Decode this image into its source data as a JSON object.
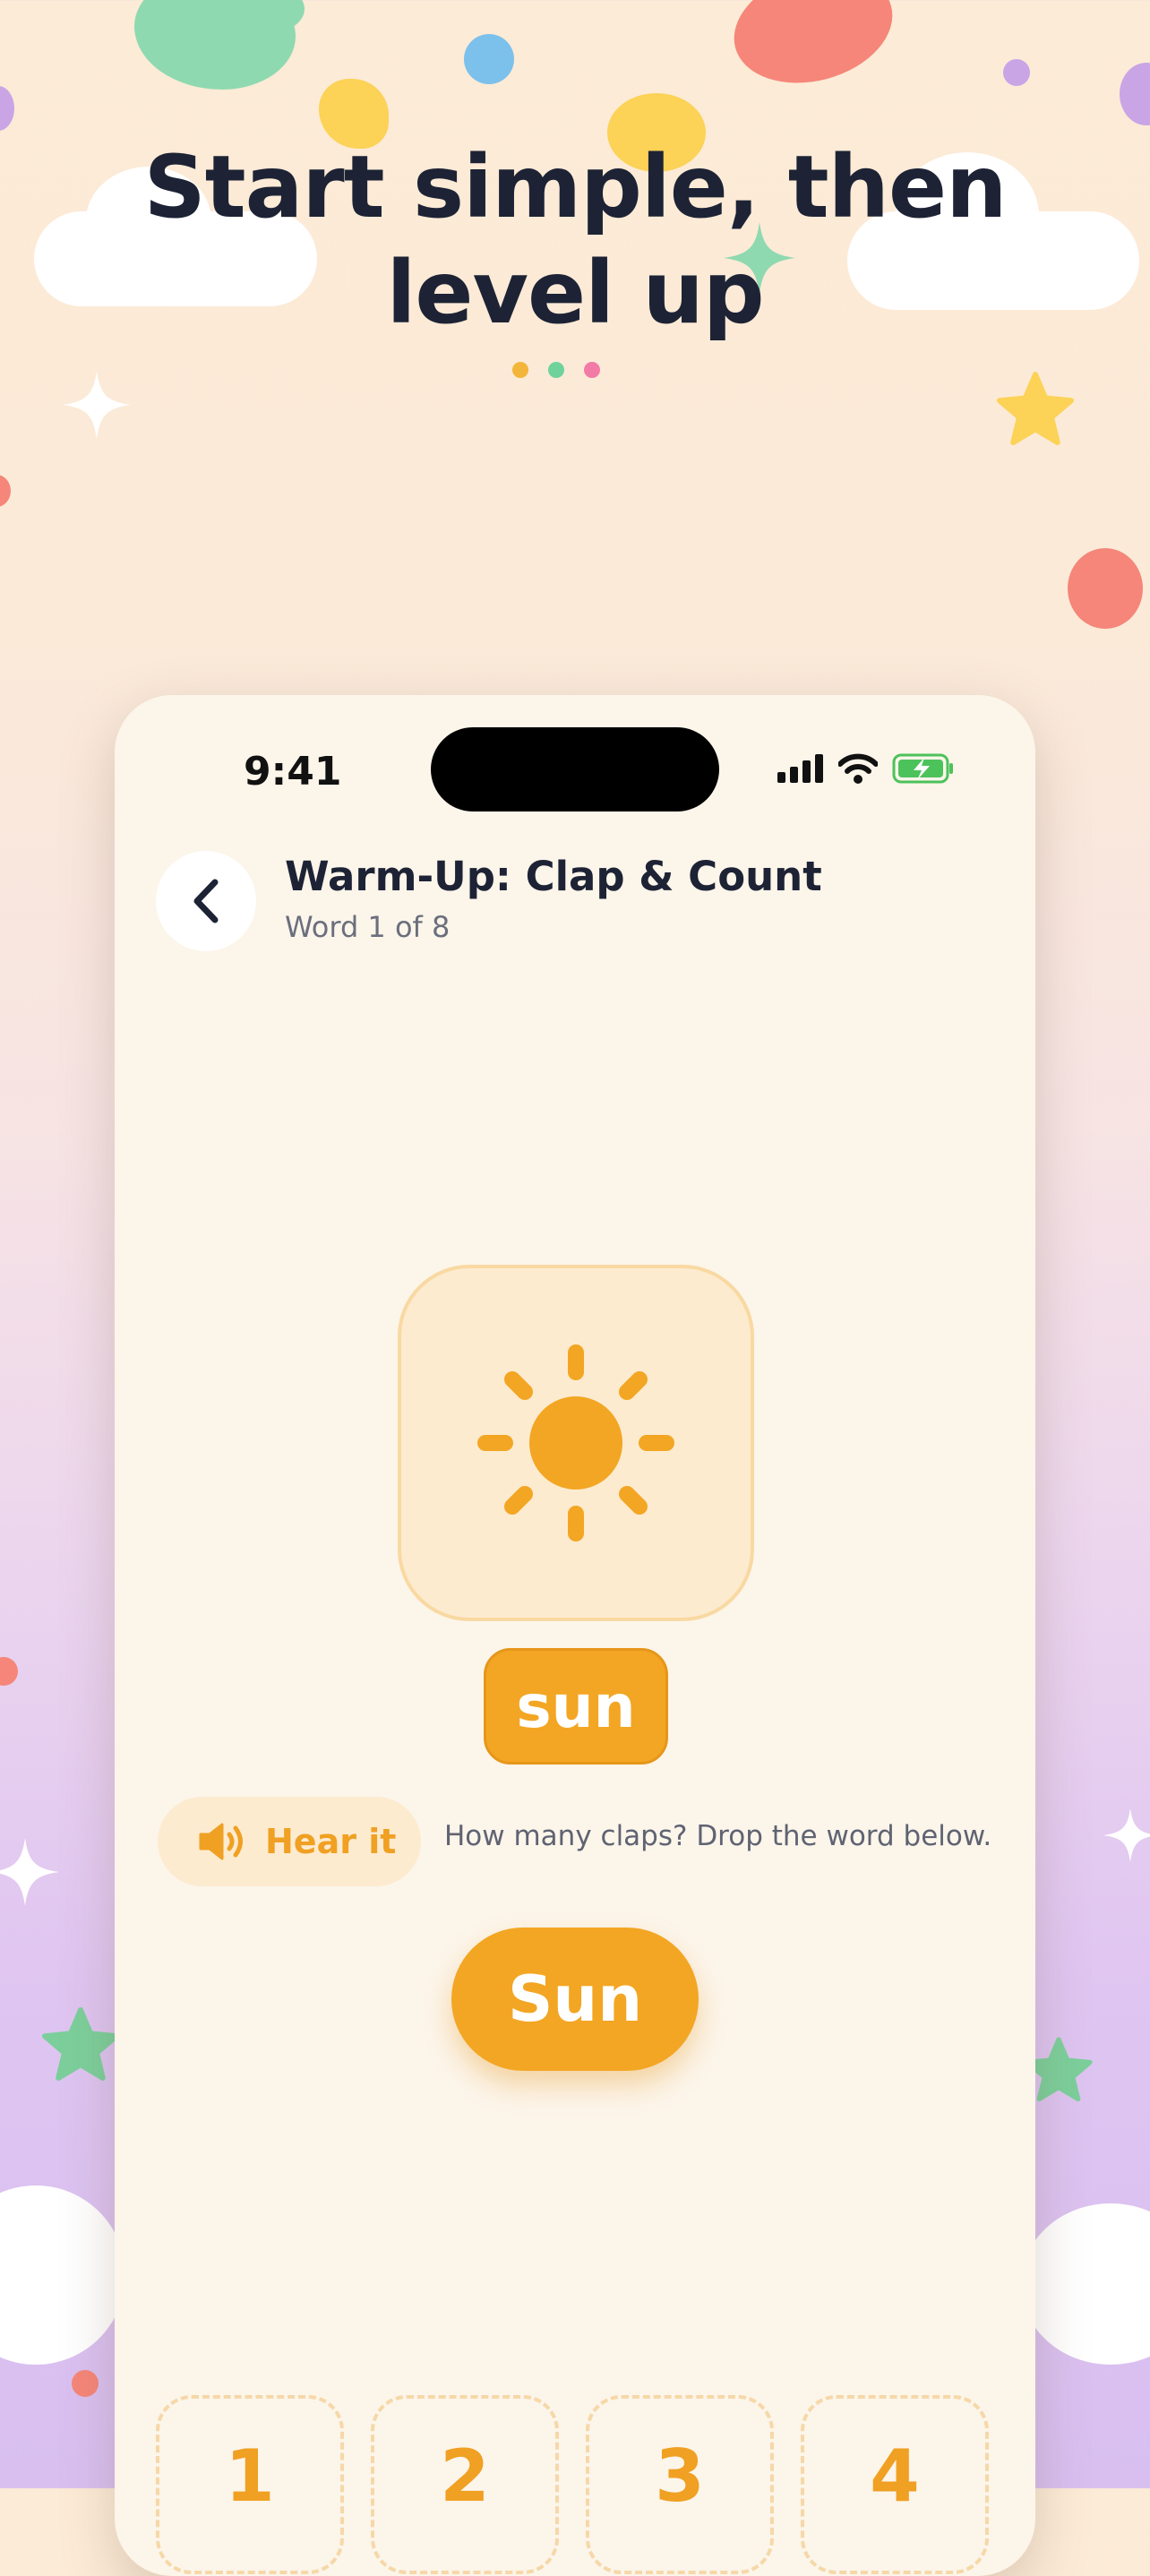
{
  "headline": "Start simple, then level up",
  "status": {
    "time": "9:41"
  },
  "header": {
    "title": "Warm-Up: Clap & Count",
    "subtitle": "Word 1 of 8"
  },
  "card": {
    "picture_icon": "sun-icon",
    "word": "sun"
  },
  "controls": {
    "hear_label": "Hear it",
    "hint": "How many claps? Drop the word below.",
    "draggable_word": "Sun"
  },
  "drop_slots": [
    "1",
    "2",
    "3",
    "4"
  ],
  "colors": {
    "accent": "#f3a623",
    "text_dark": "#1d2335",
    "card_bg": "#fcf5ea"
  }
}
